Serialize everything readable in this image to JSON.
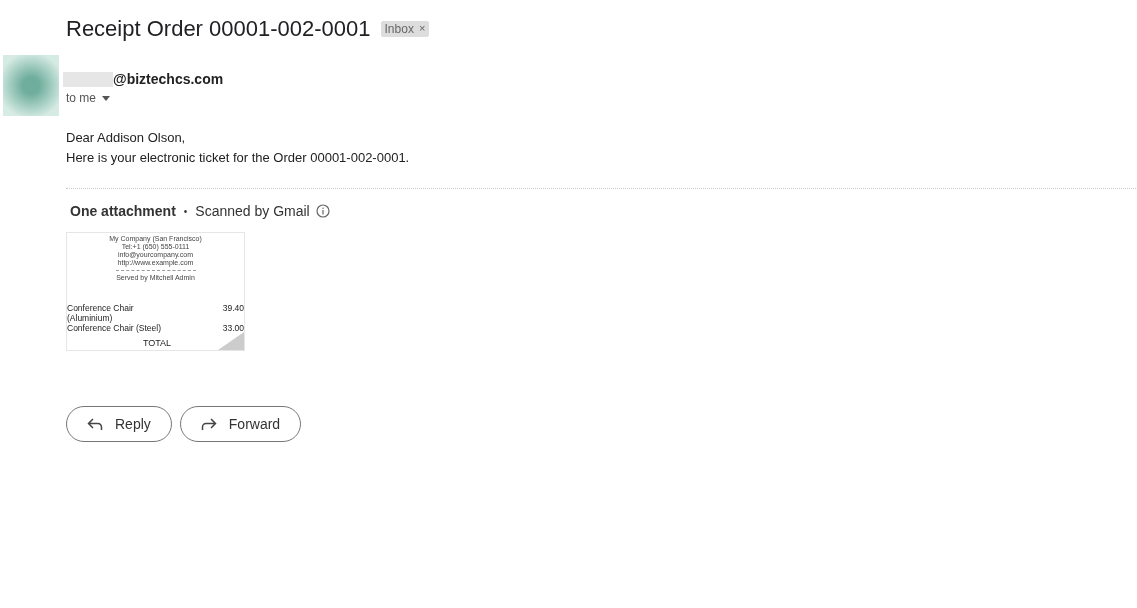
{
  "subject": "Receipt Order 00001-002-0001",
  "labels": [
    {
      "text": "Inbox",
      "close": "×"
    }
  ],
  "sender": {
    "email": "@biztechcs.com",
    "recipient": "to me"
  },
  "body": [
    "Dear Addison Olson,",
    "Here is your electronic ticket for the Order 00001-002-0001."
  ],
  "attachments": {
    "count": "One attachment",
    "separator": "•",
    "scan_note": "Scanned by Gmail",
    "preview": {
      "header": [
        "My Company (San Francisco)",
        "Tel:+1 (650) 555-0111",
        "info@yourcompany.com",
        "http://www.example.com"
      ],
      "served_by": "Served by Mitchell Admin",
      "lines": [
        {
          "item": "Conference Chair (Aluminium)",
          "price": "39.40"
        },
        {
          "item": "Conference Chair (Steel)",
          "price": "33.00"
        }
      ],
      "total": "TOTAL"
    }
  },
  "actions": [
    {
      "kind": "reply",
      "label": "Reply"
    },
    {
      "kind": "forward",
      "label": "Forward"
    }
  ]
}
